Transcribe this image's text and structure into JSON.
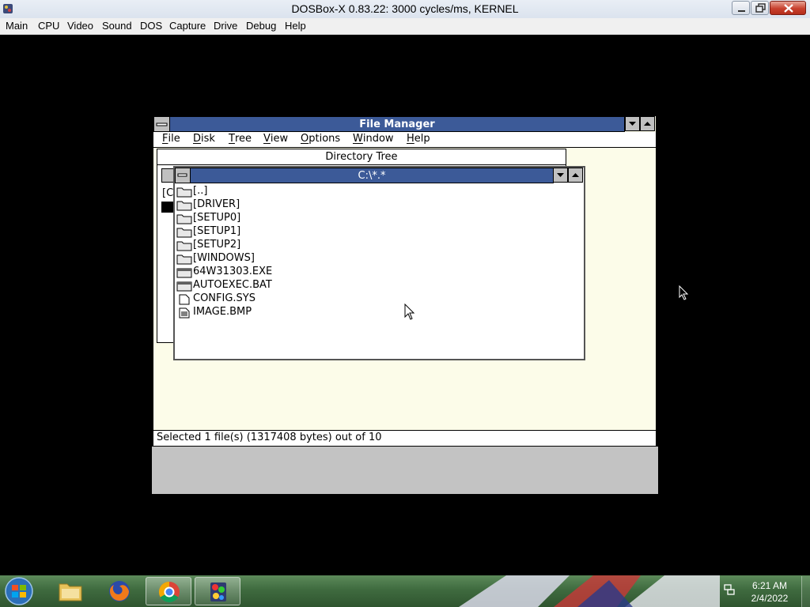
{
  "host": {
    "title": "DOSBox-X 0.83.22: 3000 cycles/ms, KERNEL",
    "menu": [
      "Main",
      "CPU",
      "Video",
      "Sound",
      "DOS",
      "Capture",
      "Drive",
      "Debug",
      "Help"
    ]
  },
  "file_manager": {
    "title": "File Manager",
    "menu": [
      {
        "key": "F",
        "rest": "ile"
      },
      {
        "key": "D",
        "rest": "isk"
      },
      {
        "key": "T",
        "rest": "ree"
      },
      {
        "key": "V",
        "rest": "iew"
      },
      {
        "key": "O",
        "rest": "ptions"
      },
      {
        "key": "W",
        "rest": "indow"
      },
      {
        "key": "H",
        "rest": "elp"
      }
    ],
    "directory_tree": {
      "title": "Directory Tree",
      "drive_label": "[C"
    },
    "file_window": {
      "title": "C:\\*.*",
      "files": [
        {
          "name": "[..]",
          "icon": "folder-icon"
        },
        {
          "name": "[DRIVER]",
          "icon": "folder-icon"
        },
        {
          "name": "[SETUP0]",
          "icon": "folder-icon"
        },
        {
          "name": "[SETUP1]",
          "icon": "folder-icon"
        },
        {
          "name": "[SETUP2]",
          "icon": "folder-icon"
        },
        {
          "name": "[WINDOWS]",
          "icon": "folder-icon"
        },
        {
          "name": "64W31303.EXE",
          "icon": "executable-icon"
        },
        {
          "name": "AUTOEXEC.BAT",
          "icon": "executable-icon"
        },
        {
          "name": "CONFIG.SYS",
          "icon": "file-icon"
        },
        {
          "name": "IMAGE.BMP",
          "icon": "document-icon"
        }
      ]
    },
    "status": "Selected 1 file(s) (1317408 bytes) out of 10"
  },
  "taskbar": {
    "time": "6:21 AM",
    "date": "2/4/2022",
    "pinned": [
      "explorer-icon",
      "firefox-icon",
      "chrome-icon",
      "dosbox-icon"
    ]
  },
  "colors": {
    "w31_titlebar": "#3c5a98",
    "fm_background": "#fcfce9",
    "desktop": "#000000"
  }
}
